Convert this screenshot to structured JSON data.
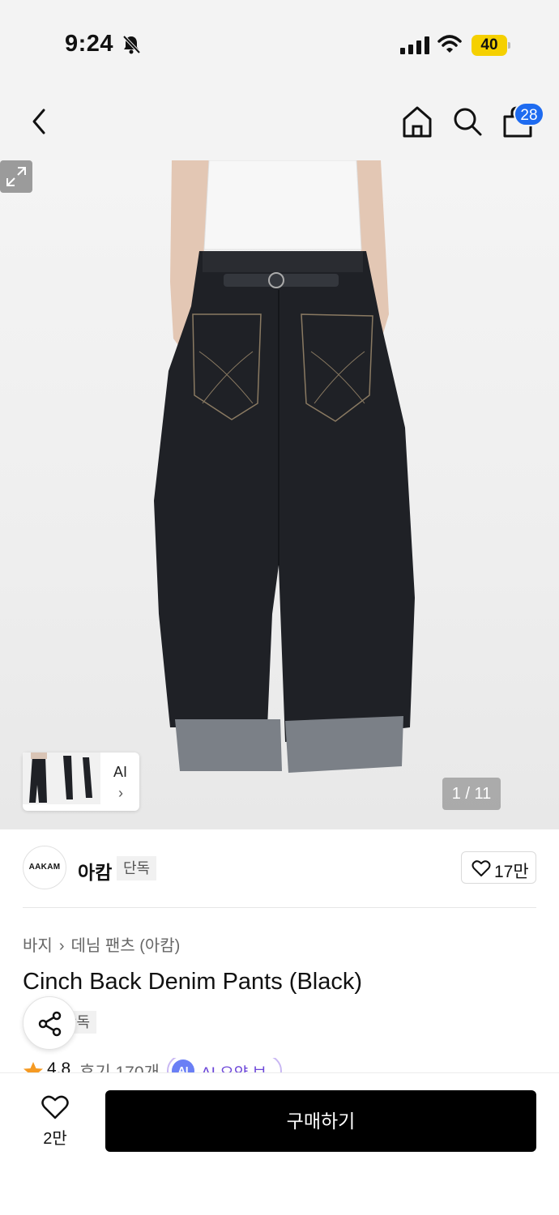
{
  "status_bar": {
    "time": "9:24",
    "battery": "40",
    "icons": [
      "bell-slash-icon",
      "cellular-signal-icon",
      "wifi-icon",
      "battery-icon"
    ]
  },
  "header": {
    "icons": [
      "chevron-left-icon",
      "home-icon",
      "search-icon",
      "shopping-bag-icon"
    ],
    "cart_count": "28"
  },
  "gallery": {
    "thumb_ai_label": "AI",
    "page_indicator": "1 / 11",
    "icons": [
      "chevron-right-icon",
      "expand-icon"
    ]
  },
  "brand": {
    "logo_text": "AAKAM",
    "name": "아캄",
    "badge": "단독",
    "likes": "17만",
    "icons": [
      "heart-icon"
    ]
  },
  "product": {
    "breadcrumb": [
      "바지",
      "데님 팬츠 (아캄)"
    ],
    "title": "Cinch Back Denim Pants (Black)",
    "exclusive_badge": "단독",
    "rating": "4.8",
    "review_summary": "후기 170개",
    "ai_chip_icon": "AI",
    "ai_chip_label": "AI 요약 보기",
    "icons": [
      "share-icon",
      "star-icon"
    ]
  },
  "bottom_bar": {
    "wish_count": "2만",
    "buy_label": "구매하기",
    "icons": [
      "heart-outline-icon"
    ]
  },
  "colors": {
    "background": "#f3f3f3",
    "cart_badge": "#1e6bf0",
    "battery": "#f5d000",
    "star": "#f59a23",
    "ai_chip_text": "#6b45d8",
    "buy_button": "#000000"
  }
}
